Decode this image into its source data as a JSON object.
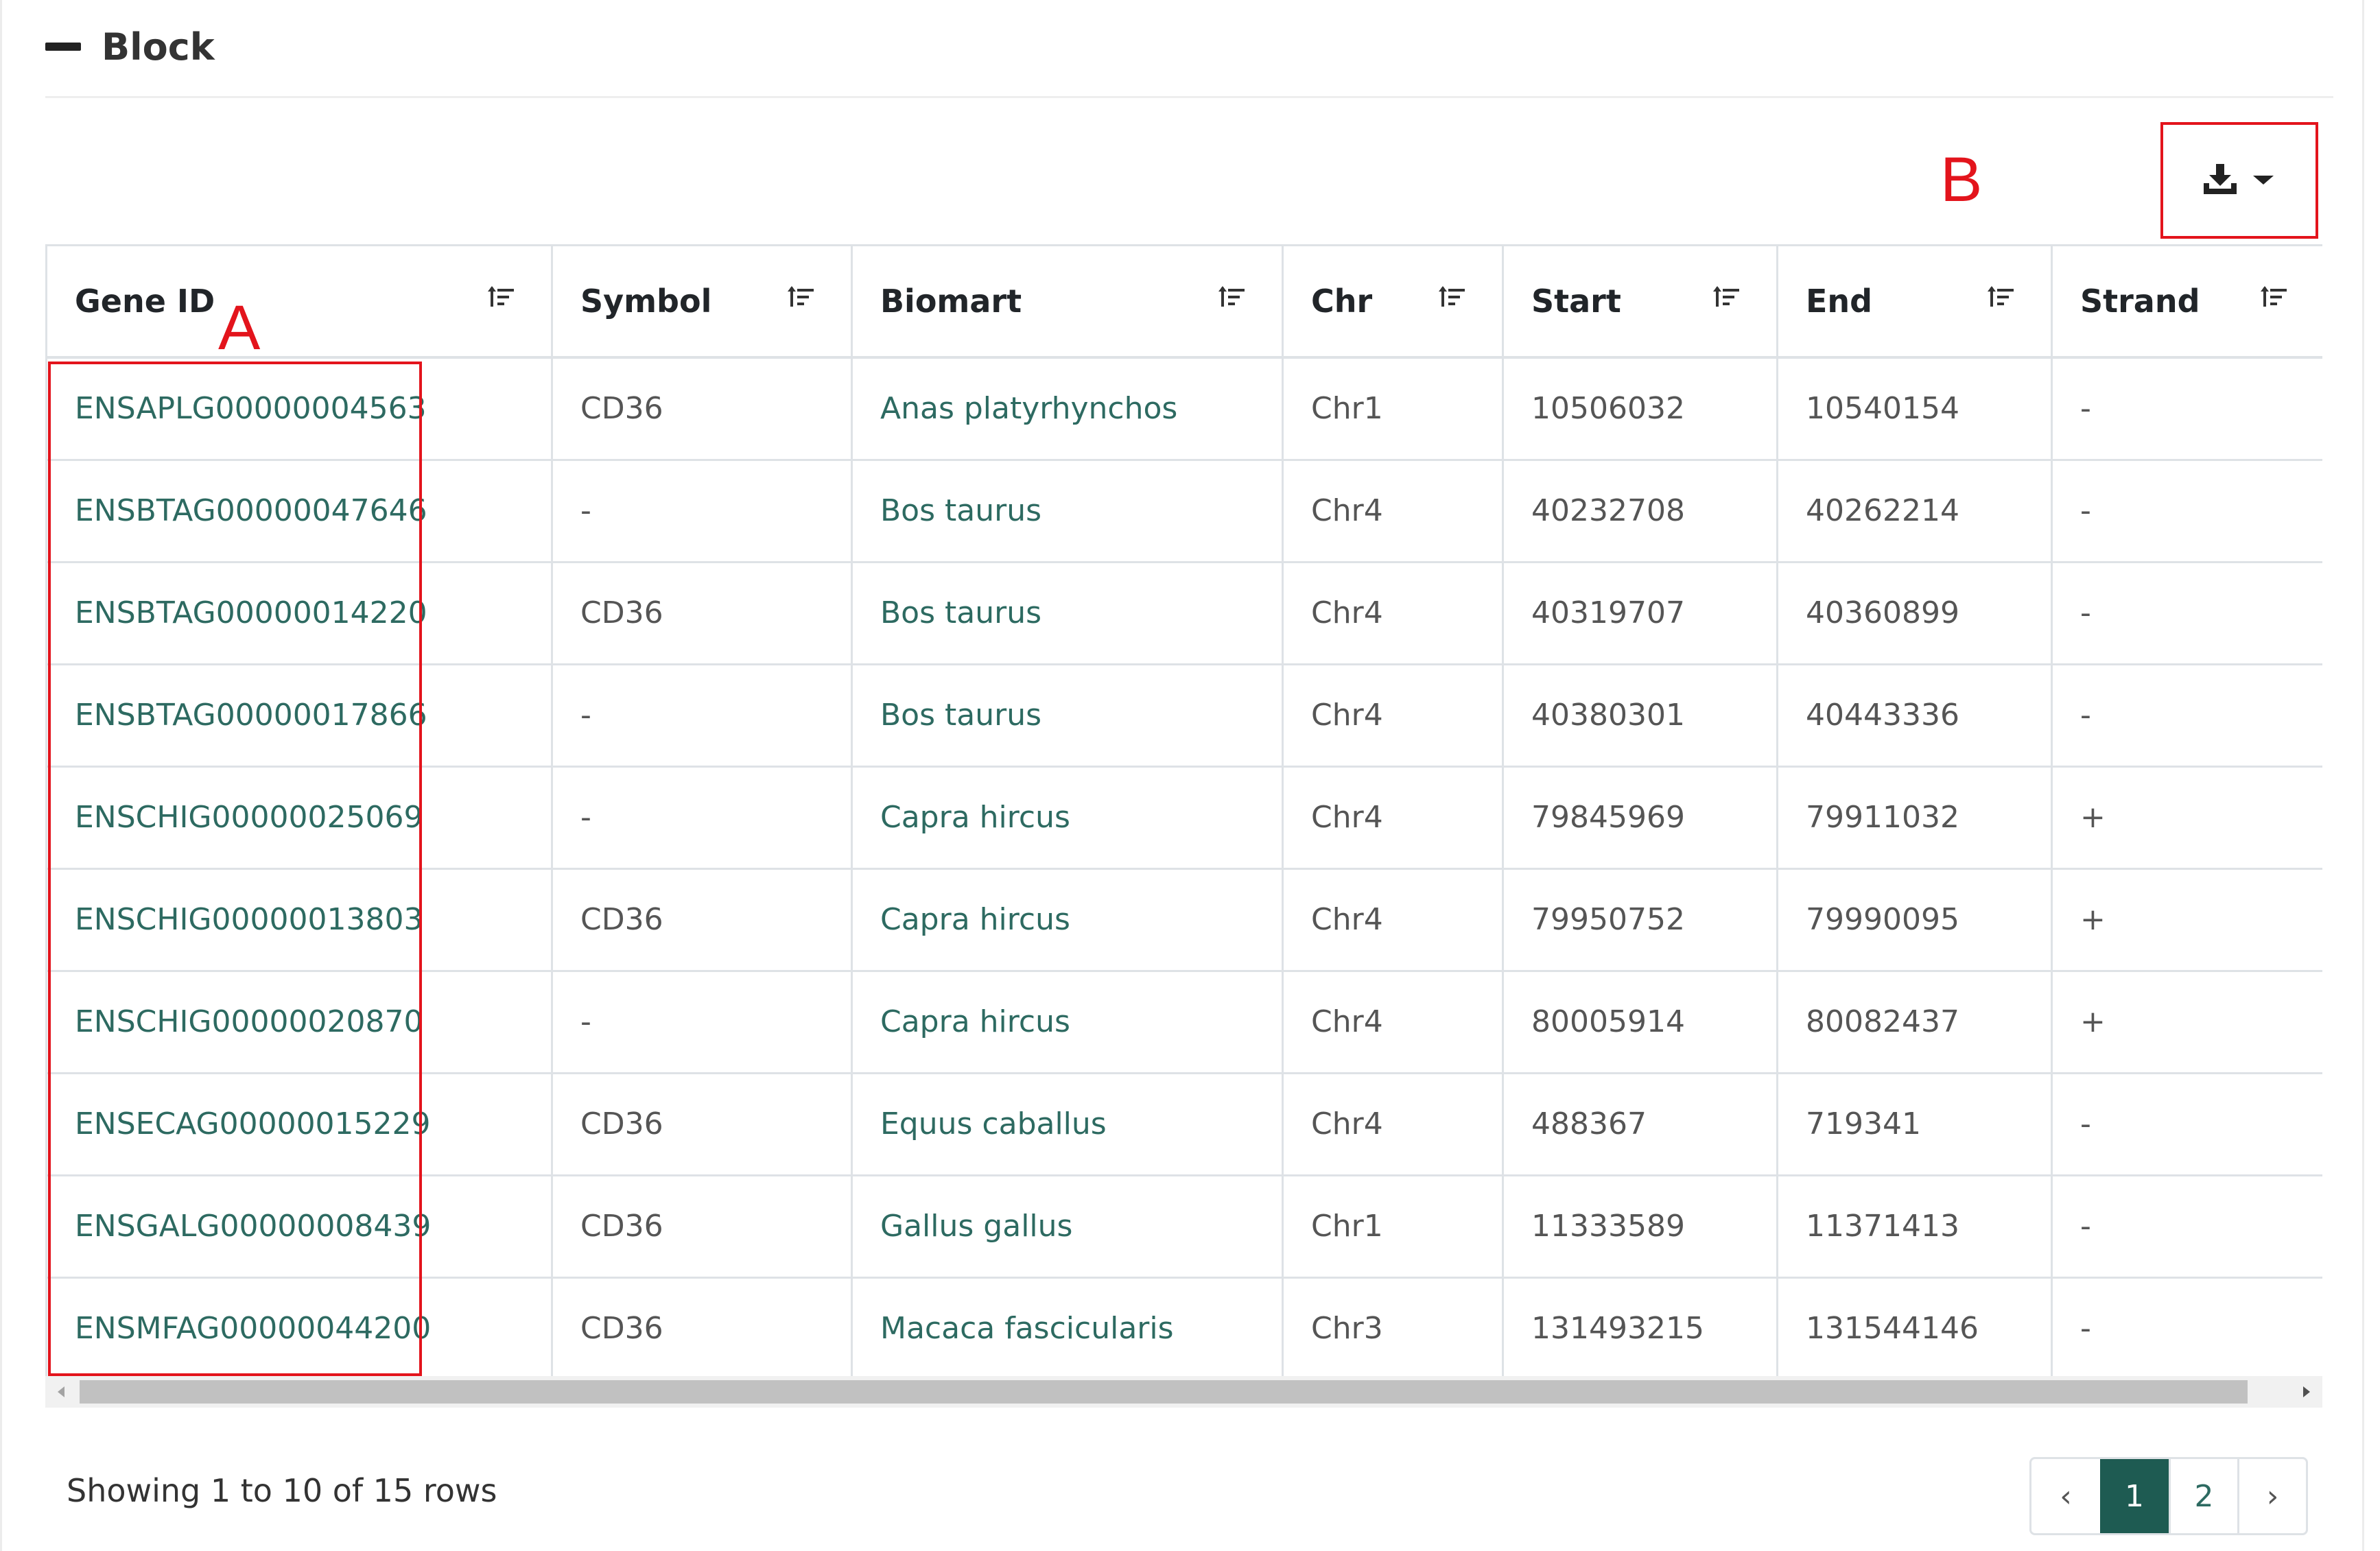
{
  "panel": {
    "title": "Block"
  },
  "annotations": {
    "gene_id_label": "A",
    "export_label": "B"
  },
  "table": {
    "columns": [
      "Gene ID",
      "Symbol",
      "Biomart",
      "Chr",
      "Start",
      "End",
      "Strand"
    ],
    "rows": [
      [
        "ENSAPLG00000004563",
        "CD36",
        "Anas platyrhynchos",
        "Chr1",
        "10506032",
        "10540154",
        "-"
      ],
      [
        "ENSBTAG00000047646",
        "-",
        "Bos taurus",
        "Chr4",
        "40232708",
        "40262214",
        "-"
      ],
      [
        "ENSBTAG00000014220",
        "CD36",
        "Bos taurus",
        "Chr4",
        "40319707",
        "40360899",
        "-"
      ],
      [
        "ENSBTAG00000017866",
        "-",
        "Bos taurus",
        "Chr4",
        "40380301",
        "40443336",
        "-"
      ],
      [
        "ENSCHIG00000025069",
        "-",
        "Capra hircus",
        "Chr4",
        "79845969",
        "79911032",
        "+"
      ],
      [
        "ENSCHIG00000013803",
        "CD36",
        "Capra hircus",
        "Chr4",
        "79950752",
        "79990095",
        "+"
      ],
      [
        "ENSCHIG00000020870",
        "-",
        "Capra hircus",
        "Chr4",
        "80005914",
        "80082437",
        "+"
      ],
      [
        "ENSECAG00000015229",
        "CD36",
        "Equus caballus",
        "Chr4",
        "488367",
        "719341",
        "-"
      ],
      [
        "ENSGALG00000008439",
        "CD36",
        "Gallus gallus",
        "Chr1",
        "11333589",
        "11371413",
        "-"
      ],
      [
        "ENSMFAG00000044200",
        "CD36",
        "Macaca fascicularis",
        "Chr3",
        "131493215",
        "131544146",
        "-"
      ]
    ]
  },
  "footer": {
    "info": "Showing 1 to 10 of 15 rows"
  },
  "pagination": {
    "prev": "‹",
    "pages": [
      "1",
      "2"
    ],
    "next": "›",
    "active": "1"
  },
  "icons": {
    "collapse": "minus-icon",
    "export": "download-icon",
    "sort": "sort-icon"
  },
  "colors": {
    "accent": "#1e5b52",
    "link": "#2d6a61",
    "annotation": "#e3141c"
  }
}
